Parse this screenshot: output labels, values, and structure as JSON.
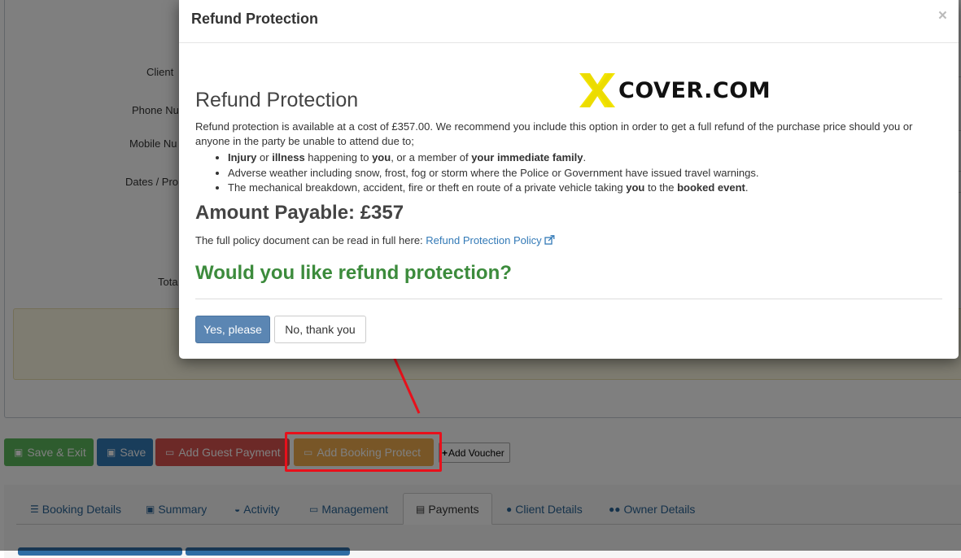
{
  "background": {
    "labels": {
      "client": "Client",
      "phone": "Phone Nu",
      "mobile": "Mobile Nu",
      "dates": "Dates / Pro",
      "total": "Tota"
    },
    "actions": {
      "save_exit": "Save & Exit",
      "save": "Save",
      "add_guest_payment": "Add Guest Payment",
      "add_booking_protect": "Add Booking Protect",
      "add_voucher": "Add Voucher"
    },
    "tabs": [
      {
        "label": "Booking Details",
        "icon": "list-icon"
      },
      {
        "label": "Summary",
        "icon": "money-icon"
      },
      {
        "label": "Activity",
        "icon": "dashboard-icon"
      },
      {
        "label": "Management",
        "icon": "desktop-icon"
      },
      {
        "label": "Payments",
        "icon": "credit-card-icon",
        "active": true
      },
      {
        "label": "Client Details",
        "icon": "user-icon"
      },
      {
        "label": "Owner Details",
        "icon": "users-icon"
      }
    ]
  },
  "modal": {
    "title": "Refund Protection",
    "close": "×",
    "logo_text": "COVER.COM",
    "heading": "Refund Protection",
    "intro": "Refund protection is available at a cost of £357.00. We recommend you include this option in order to get a full refund of the purchase price should you or anyone in the party be unable to attend due to;",
    "bullets": {
      "b1": {
        "p1": "Injury",
        "p2": " or ",
        "p3": "illness",
        "p4": " happening to ",
        "p5": "you",
        "p6": ", or a member of ",
        "p7": "your immediate family",
        "p8": "."
      },
      "b2": "Adverse weather including snow, frost, fog or storm where the Police or Government have issued travel warnings.",
      "b3": {
        "p1": "The mechanical breakdown, accident, fire or theft en route of a private vehicle taking ",
        "p2": "you",
        "p3": " to the ",
        "p4": "booked event",
        "p5": "."
      }
    },
    "amount": "Amount Payable: £357",
    "policy_text": "The full policy document can be read in full here: ",
    "policy_link": "Refund Protection Policy",
    "question": "Would you like refund protection?",
    "yes_label": "Yes, please",
    "no_label": "No, thank you"
  },
  "colors": {
    "accent_green": "#3c8b3c",
    "link_blue": "#337ab7",
    "highlight_red": "#e8101b",
    "logo_yellow": "#f3e500"
  }
}
